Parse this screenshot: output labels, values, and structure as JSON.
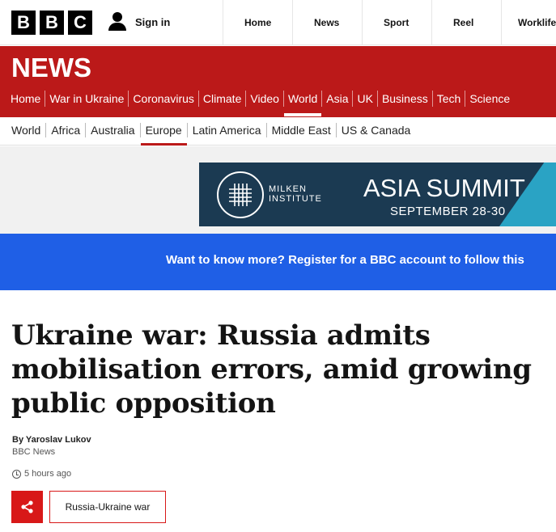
{
  "header": {
    "logo_letters": [
      "B",
      "B",
      "C"
    ],
    "signin_label": "Sign in",
    "nav": [
      "Home",
      "News",
      "Sport",
      "Reel",
      "Worklife"
    ]
  },
  "news": {
    "title": "NEWS",
    "nav": [
      "Home",
      "War in Ukraine",
      "Coronavirus",
      "Climate",
      "Video",
      "World",
      "Asia",
      "UK",
      "Business",
      "Tech",
      "Science"
    ],
    "active_nav": "World"
  },
  "subnav": {
    "items": [
      "World",
      "Africa",
      "Australia",
      "Europe",
      "Latin America",
      "Middle East",
      "US & Canada"
    ],
    "active": "Europe"
  },
  "ad": {
    "org_line1": "MILKEN",
    "org_line2": "INSTITUTE",
    "title": "ASIA SUMMIT",
    "dates": "SEPTEMBER 28-30"
  },
  "banner": {
    "text": "Want to know more? Register for a BBC account to follow this"
  },
  "article": {
    "headline": "Ukraine war: Russia admits mobilisation errors, amid growing public opposition",
    "byline": "By Yaroslav Lukov",
    "source": "BBC News",
    "time": "5 hours ago",
    "tag": "Russia-Ukraine war"
  },
  "colors": {
    "brand_red": "#bb1919",
    "banner_blue": "#1f5fe6",
    "ad_navy": "#1b3a52",
    "share_red": "#d81818"
  }
}
